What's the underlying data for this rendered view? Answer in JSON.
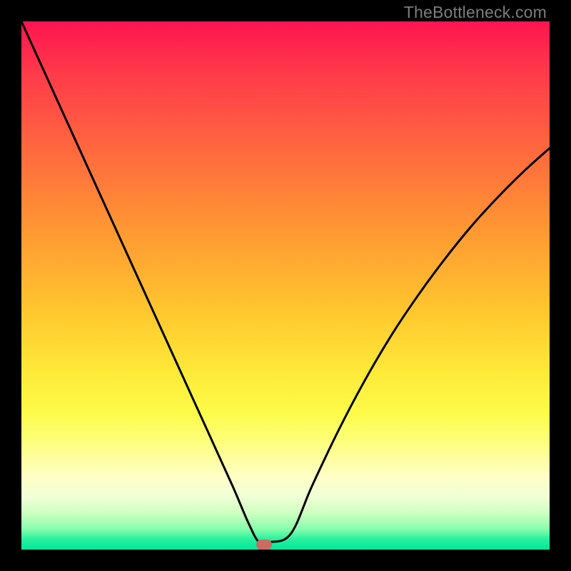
{
  "watermark": "TheBottleneck.com",
  "chart_data": {
    "type": "line",
    "title": "",
    "xlabel": "",
    "ylabel": "",
    "xlim": [
      0,
      1
    ],
    "ylim": [
      0,
      1
    ],
    "grid": false,
    "series": [
      {
        "name": "curve",
        "x": [
          0.0,
          0.05,
          0.1,
          0.15,
          0.2,
          0.25,
          0.3,
          0.35,
          0.4,
          0.43,
          0.45,
          0.47,
          0.51,
          0.55,
          0.6,
          0.65,
          0.7,
          0.75,
          0.8,
          0.85,
          0.9,
          0.95,
          1.0
        ],
        "y": [
          1.0,
          0.89,
          0.78,
          0.67,
          0.56,
          0.45,
          0.34,
          0.23,
          0.12,
          0.05,
          0.014,
          0.014,
          0.03,
          0.12,
          0.225,
          0.32,
          0.405,
          0.48,
          0.548,
          0.61,
          0.665,
          0.715,
          0.76
        ]
      }
    ],
    "marker": {
      "x": 0.46,
      "y": 0.01,
      "color": "#cc6b63"
    }
  },
  "colors": {
    "curve": "#000000",
    "marker": "#cc6b63",
    "frame": "#000000"
  }
}
